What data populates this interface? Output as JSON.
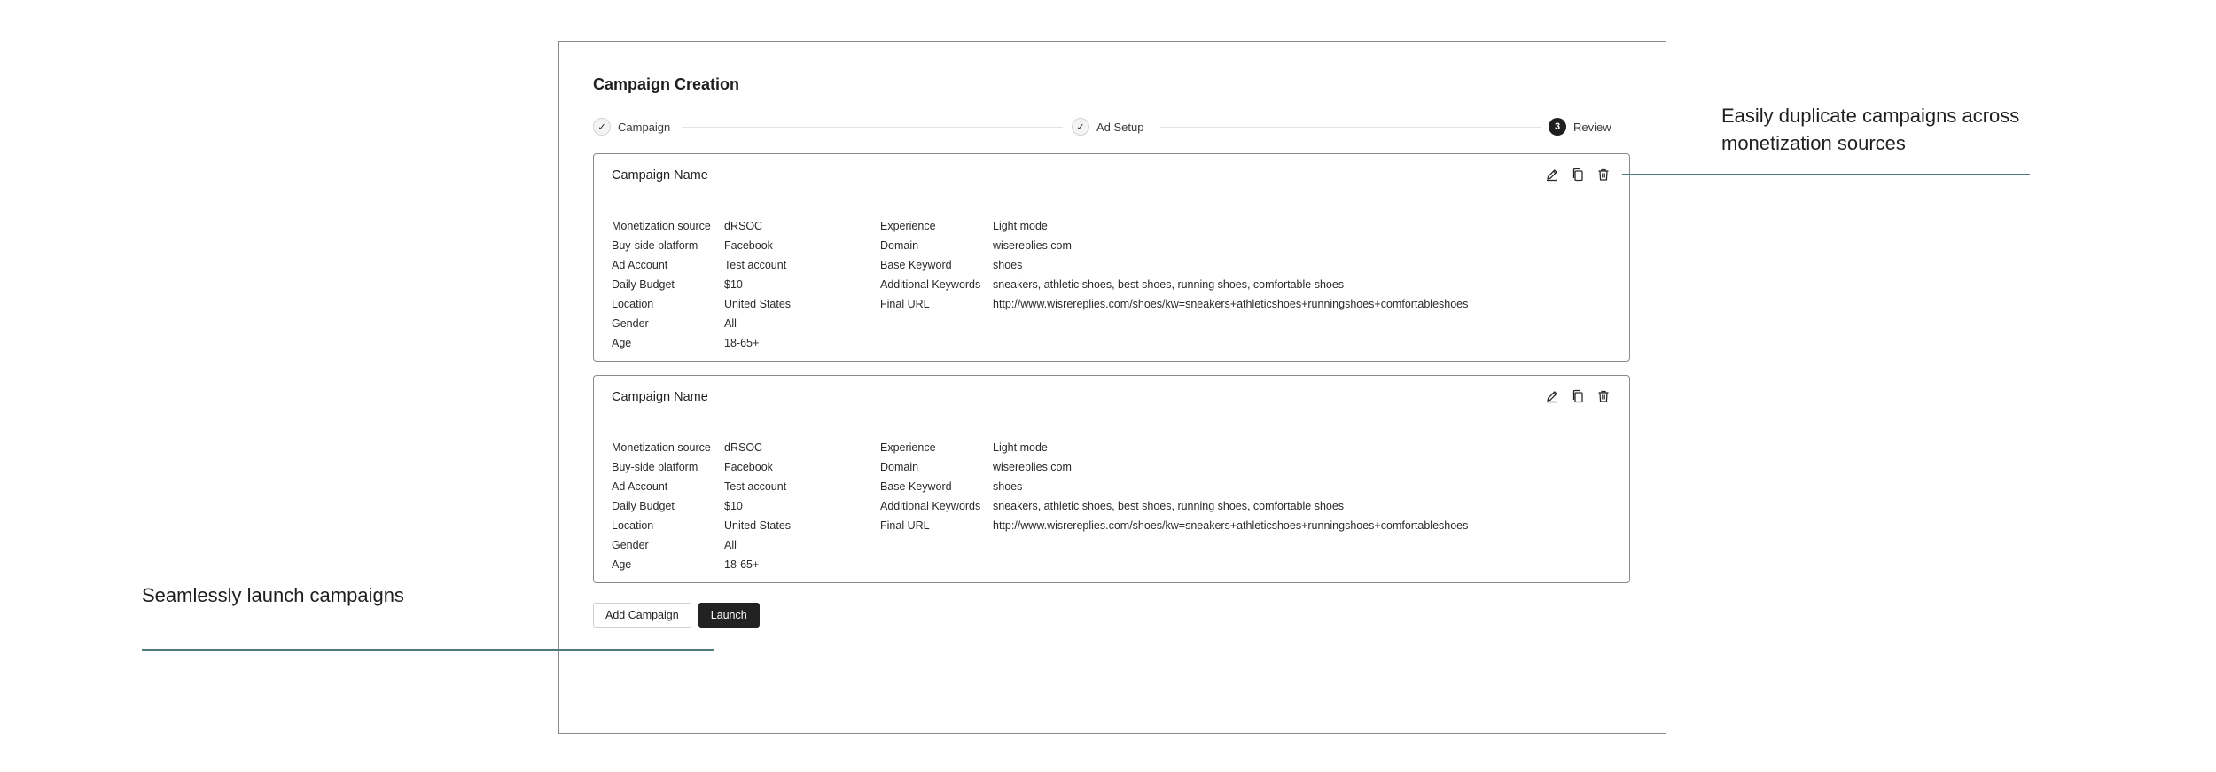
{
  "page_title": "Campaign Creation",
  "stepper": {
    "steps": [
      {
        "label": "Campaign",
        "state": "done",
        "marker": "✓"
      },
      {
        "label": "Ad Setup",
        "state": "done",
        "marker": "✓"
      },
      {
        "label": "Review",
        "state": "active",
        "marker": "3"
      }
    ]
  },
  "campaigns": [
    {
      "title": "Campaign Name",
      "left": [
        {
          "label": "Monetization source",
          "value": "dRSOC"
        },
        {
          "label": "Buy-side platform",
          "value": "Facebook"
        },
        {
          "label": "Ad Account",
          "value": "Test account"
        },
        {
          "label": "Daily Budget",
          "value": "$10"
        },
        {
          "label": "Location",
          "value": "United States"
        },
        {
          "label": "Gender",
          "value": "All"
        },
        {
          "label": "Age",
          "value": "18-65+"
        }
      ],
      "right": [
        {
          "label": "Experience",
          "value": "Light mode"
        },
        {
          "label": "Domain",
          "value": "wisereplies.com"
        },
        {
          "label": "Base Keyword",
          "value": "shoes"
        },
        {
          "label": "Additional Keywords",
          "value": "sneakers, athletic shoes, best shoes, running shoes, comfortable shoes"
        },
        {
          "label": "Final URL",
          "value": "http://www.wisrereplies.com/shoes/kw=sneakers+athleticshoes+runningshoes+comfortableshoes"
        }
      ]
    },
    {
      "title": "Campaign Name",
      "left": [
        {
          "label": "Monetization source",
          "value": "dRSOC"
        },
        {
          "label": "Buy-side platform",
          "value": "Facebook"
        },
        {
          "label": "Ad Account",
          "value": "Test account"
        },
        {
          "label": "Daily Budget",
          "value": "$10"
        },
        {
          "label": "Location",
          "value": "United States"
        },
        {
          "label": "Gender",
          "value": "All"
        },
        {
          "label": "Age",
          "value": "18-65+"
        }
      ],
      "right": [
        {
          "label": "Experience",
          "value": "Light mode"
        },
        {
          "label": "Domain",
          "value": "wisereplies.com"
        },
        {
          "label": "Base Keyword",
          "value": "shoes"
        },
        {
          "label": "Additional Keywords",
          "value": "sneakers, athletic shoes, best shoes, running shoes, comfortable shoes"
        },
        {
          "label": "Final URL",
          "value": "http://www.wisrereplies.com/shoes/kw=sneakers+athleticshoes+runningshoes+comfortableshoes"
        }
      ]
    }
  ],
  "actions": {
    "add_campaign": "Add Campaign",
    "launch": "Launch"
  },
  "card_action_icons": [
    "edit-icon",
    "copy-icon",
    "trash-icon"
  ],
  "annotations": {
    "right_text": "Easily duplicate campaigns across monetization sources",
    "left_text": "Seamlessly launch campaigns"
  },
  "colors": {
    "primary_button": "#222222",
    "annotation_line": "#4f7a80",
    "frame_border": "#8a8a8a"
  }
}
